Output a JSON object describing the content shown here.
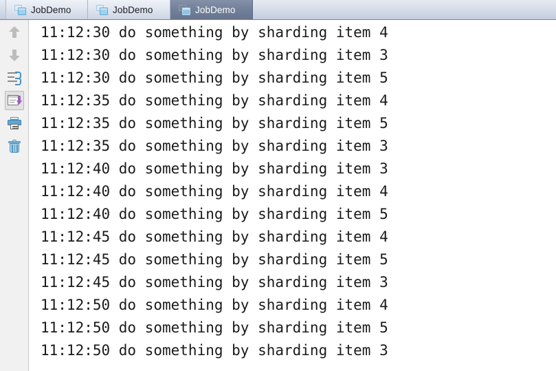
{
  "tabs": [
    {
      "label": "JobDemo",
      "icon": "console-window-icon",
      "selected": false
    },
    {
      "label": "JobDemo",
      "icon": "console-window-icon",
      "selected": false
    },
    {
      "label": "JobDemo",
      "icon": "console-window-icon",
      "selected": true
    }
  ],
  "toolbar": {
    "buttons": [
      {
        "name": "previous-occurrence-button",
        "icon": "arrow-up-icon",
        "state": "disabled"
      },
      {
        "name": "next-occurrence-button",
        "icon": "arrow-down-icon",
        "state": "disabled"
      },
      {
        "name": "soft-wrap-button",
        "icon": "soft-wrap-icon",
        "state": "normal"
      },
      {
        "name": "scroll-to-end-button",
        "icon": "scroll-to-end-icon",
        "state": "toggled"
      },
      {
        "name": "print-button",
        "icon": "printer-icon",
        "state": "normal"
      },
      {
        "name": "clear-all-button",
        "icon": "trash-icon",
        "state": "normal"
      }
    ]
  },
  "console": {
    "lines": [
      "11:12:30 do something by sharding item 4",
      "11:12:30 do something by sharding item 3",
      "11:12:30 do something by sharding item 5",
      "11:12:35 do something by sharding item 4",
      "11:12:35 do something by sharding item 5",
      "11:12:35 do something by sharding item 3",
      "11:12:40 do something by sharding item 3",
      "11:12:40 do something by sharding item 4",
      "11:12:40 do something by sharding item 5",
      "11:12:45 do something by sharding item 4",
      "11:12:45 do something by sharding item 5",
      "11:12:45 do something by sharding item 3",
      "11:12:50 do something by sharding item 4",
      "11:12:50 do something by sharding item 5",
      "11:12:50 do something by sharding item 3"
    ]
  },
  "colors": {
    "tab_selected_bg": "#74819a",
    "tab_bar_bg": "#d3dbe8",
    "toolbar_bg": "#f1f1f1",
    "console_bg": "#ffffff",
    "console_text": "#1a1a1a",
    "accent_blue": "#5fa8d3",
    "accent_purple": "#a05bc8"
  }
}
